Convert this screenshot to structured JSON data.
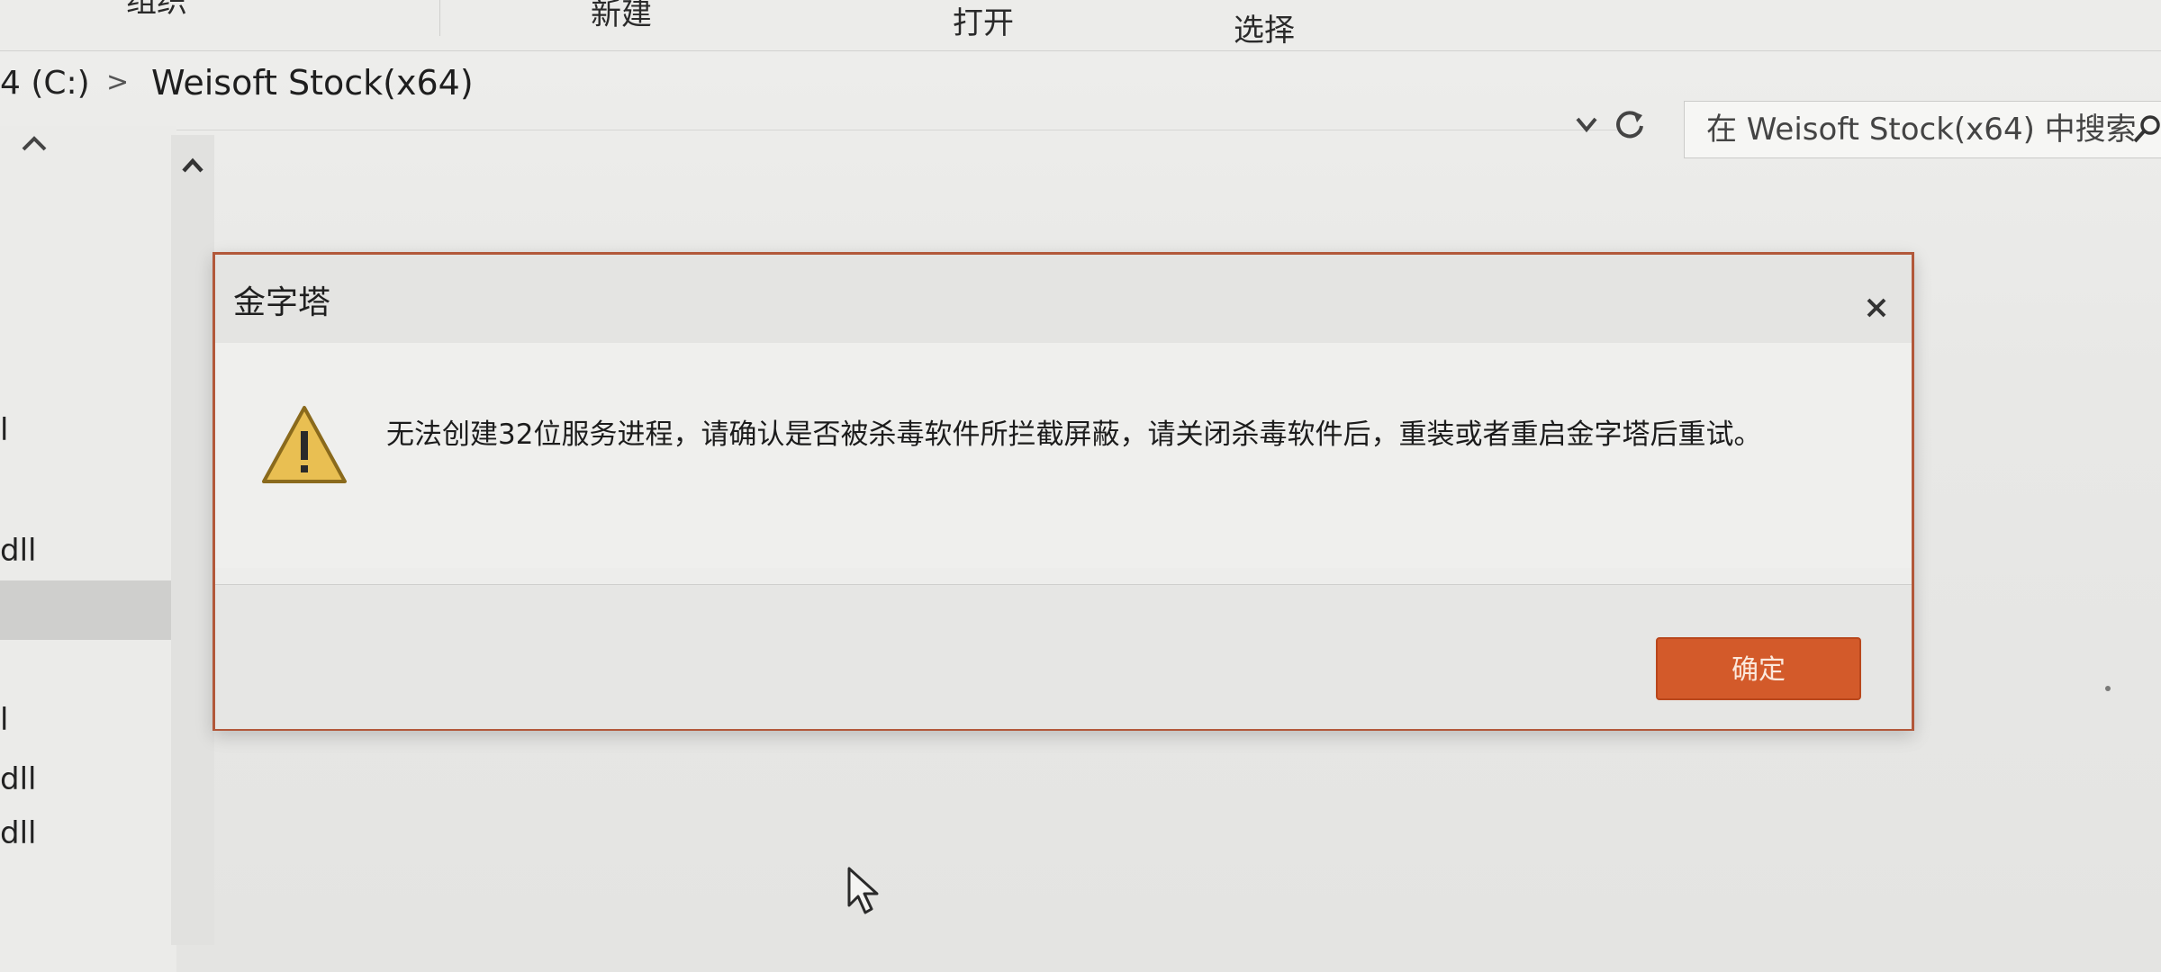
{
  "ribbon": {
    "items": [
      "组织",
      "新建",
      "打开",
      "选择"
    ]
  },
  "address": {
    "drive": "4 (C:)",
    "separator": ">",
    "folder": "Weisoft Stock(x64)"
  },
  "search": {
    "placeholder": "在 Weisoft Stock(x64) 中搜索"
  },
  "navpane": {
    "fragments": [
      "l",
      "dll",
      "l",
      "dll",
      "dll"
    ]
  },
  "dialog": {
    "title": "金字塔",
    "message": "无法创建32位服务进程，请确认是否被杀毒软件所拦截屏蔽，请关闭杀毒软件后，重装或者重启金字塔后重试。",
    "ok_label": "确定"
  },
  "colors": {
    "accent": "#d35a2a",
    "dialog_border": "#b2583a",
    "warning_fill": "#e9bf52"
  },
  "icons": {
    "warning": "warning-icon",
    "close": "close-icon",
    "search": "search-icon",
    "refresh": "refresh-icon",
    "dropdown": "chevron-down-icon",
    "scroll_up": "chevron-up-icon",
    "cursor": "mouse-pointer-icon"
  }
}
